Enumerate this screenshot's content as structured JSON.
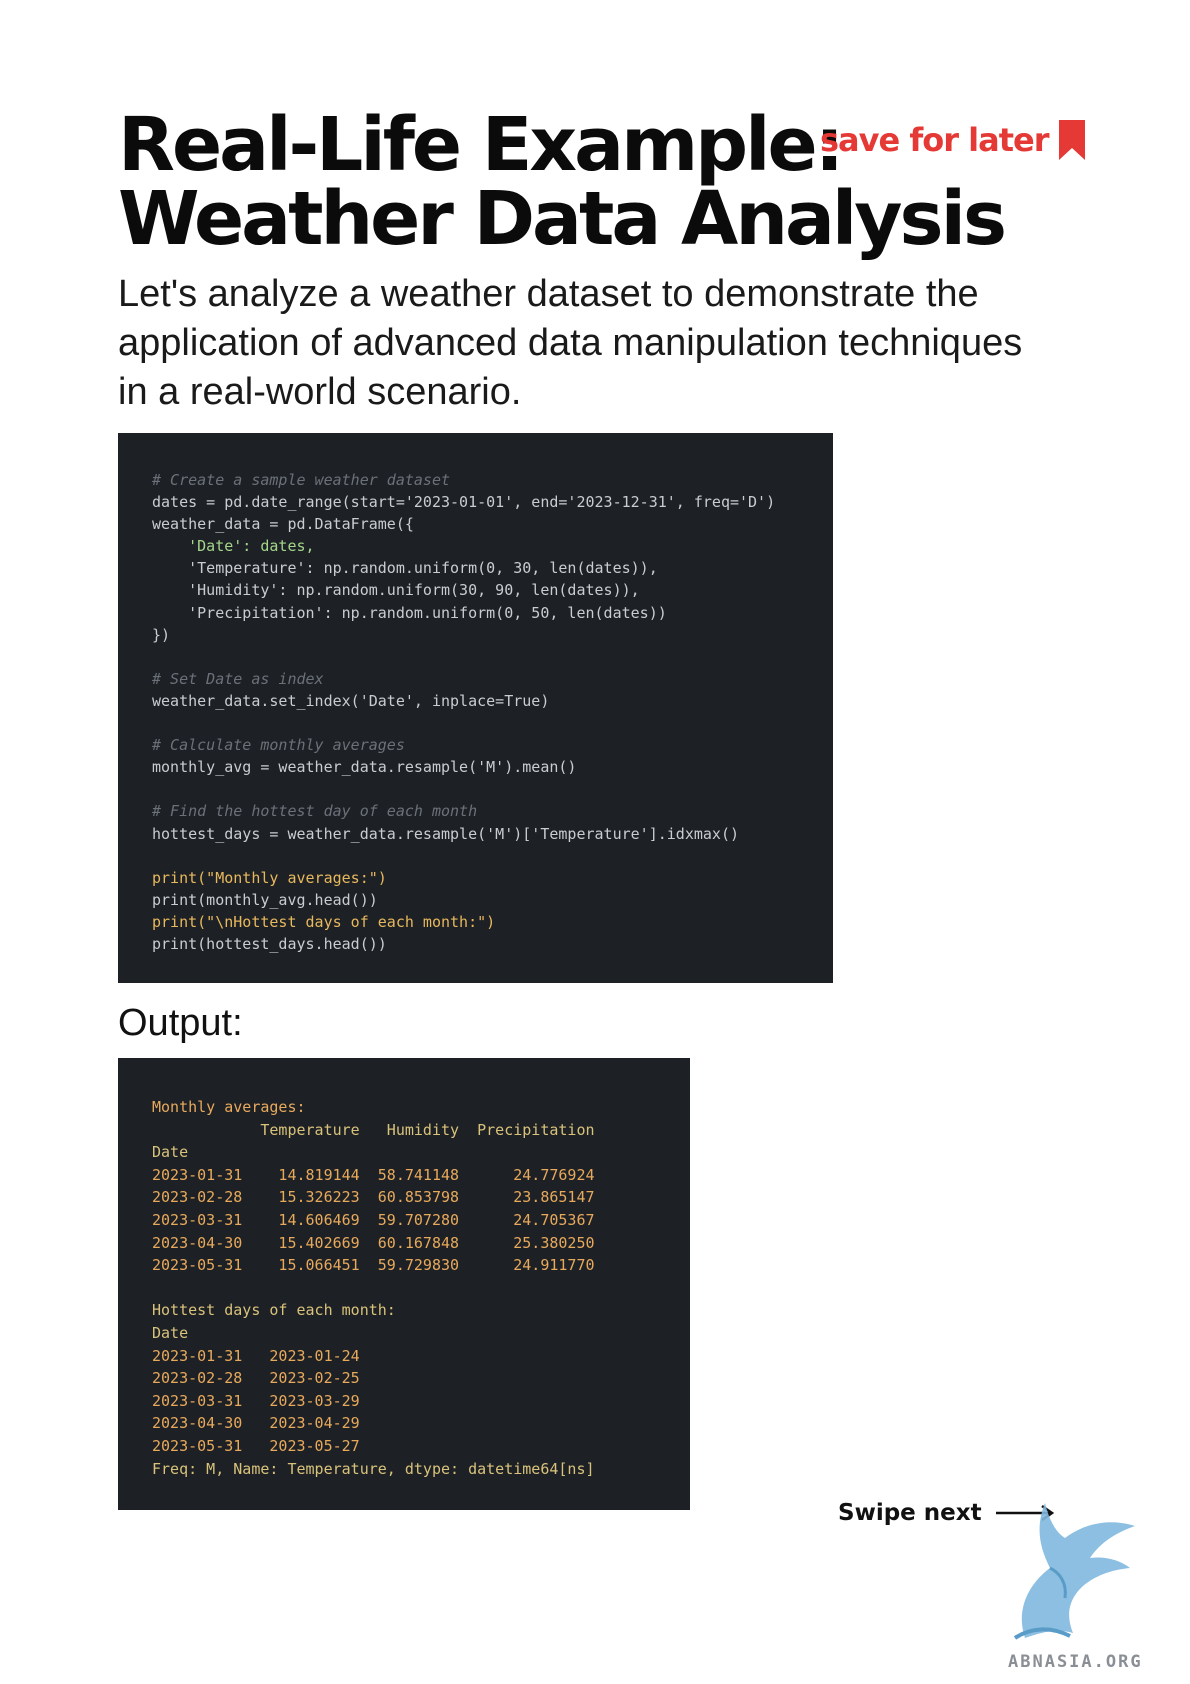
{
  "header": {
    "title_line1": "Real-Life Example:",
    "title_line2": "Weather Data Analysis",
    "save_label": "save for later",
    "save_color": "#e53935"
  },
  "intro": "Let's analyze a weather dataset to demonstrate the application of advanced data manipulation techniques in a real-world scenario.",
  "code_lines": [
    "# Create a sample weather dataset",
    "dates = pd.date_range(start='2023-01-01', end='2023-12-31', freq='D')",
    "weather_data = pd.DataFrame({",
    "    'Date': dates,",
    "    'Temperature': np.random.uniform(0, 30, len(dates)),",
    "    'Humidity': np.random.uniform(30, 90, len(dates)),",
    "    'Precipitation': np.random.uniform(0, 50, len(dates))",
    "})",
    "",
    "# Set Date as index",
    "weather_data.set_index('Date', inplace=True)",
    "",
    "# Calculate monthly averages",
    "monthly_avg = weather_data.resample('M').mean()",
    "",
    "# Find the hottest day of each month",
    "hottest_days = weather_data.resample('M')['Temperature'].idxmax()",
    "",
    "print(\"Monthly averages:\")",
    "print(monthly_avg.head())",
    "print(\"\\nHottest days of each month:\")",
    "print(hottest_days.head())"
  ],
  "output_label": "Output:",
  "output_lines": [
    "Monthly averages:",
    "            Temperature   Humidity  Precipitation",
    "Date",
    "2023-01-31    14.819144  58.741148      24.776924",
    "2023-02-28    15.326223  60.853798      23.865147",
    "2023-03-31    14.606469  59.707280      24.705367",
    "2023-04-30    15.402669  60.167848      25.380250",
    "2023-05-31    15.066451  59.729830      24.911770",
    "",
    "Hottest days of each month:",
    "Date",
    "2023-01-31   2023-01-24",
    "2023-02-28   2023-02-25",
    "2023-03-31   2023-03-29",
    "2023-04-30   2023-04-29",
    "2023-05-31   2023-05-27",
    "Freq: M, Name: Temperature, dtype: datetime64[ns]"
  ],
  "footer": {
    "swipe_label": "Swipe next",
    "logo_text": "ABNASIA.ORG"
  },
  "icons": {
    "bookmark": "bookmark-icon",
    "arrow": "arrow-right-icon",
    "logo": "dragon-logo"
  },
  "colors": {
    "code_bg": "#1d2126",
    "code_text": "#c9ccd1",
    "comment": "#6b7079",
    "string": "#a5d68a",
    "number": "#e6a45c",
    "keyword": "#e8b85c",
    "output_text": "#e8a95b"
  }
}
